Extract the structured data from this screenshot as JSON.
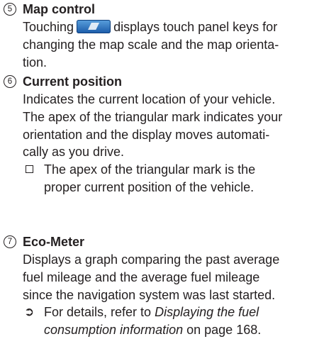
{
  "items": [
    {
      "number": "5",
      "title": "Map control",
      "body": {
        "line1_before": "Touching",
        "icon": "map-control-key-icon",
        "line1_after": "displays touch panel keys for",
        "line2": "changing the map scale and the map orienta-",
        "line3": "tion."
      }
    },
    {
      "number": "6",
      "title": "Current position",
      "body_lines": [
        "Indicates the current location of your vehicle.",
        "The apex of the triangular mark indicates your",
        "orientation and the display moves automati-",
        "cally as you drive."
      ],
      "note": {
        "mark_icon": "checkbox-note-icon",
        "lines": [
          "The apex of the triangular mark is the",
          "proper current position of the vehicle."
        ]
      }
    },
    {
      "number": "7",
      "title": "Eco-Meter",
      "body_lines": [
        "Displays a graph comparing the past average",
        "fuel mileage and the average fuel mileage",
        "since the navigation system was last started."
      ],
      "reference": {
        "arrow": "➲",
        "prefix": "For details, refer to",
        "link_part1": "Displaying the fuel",
        "link_part2": "consumption information",
        "suffix": "on page 168."
      }
    }
  ]
}
